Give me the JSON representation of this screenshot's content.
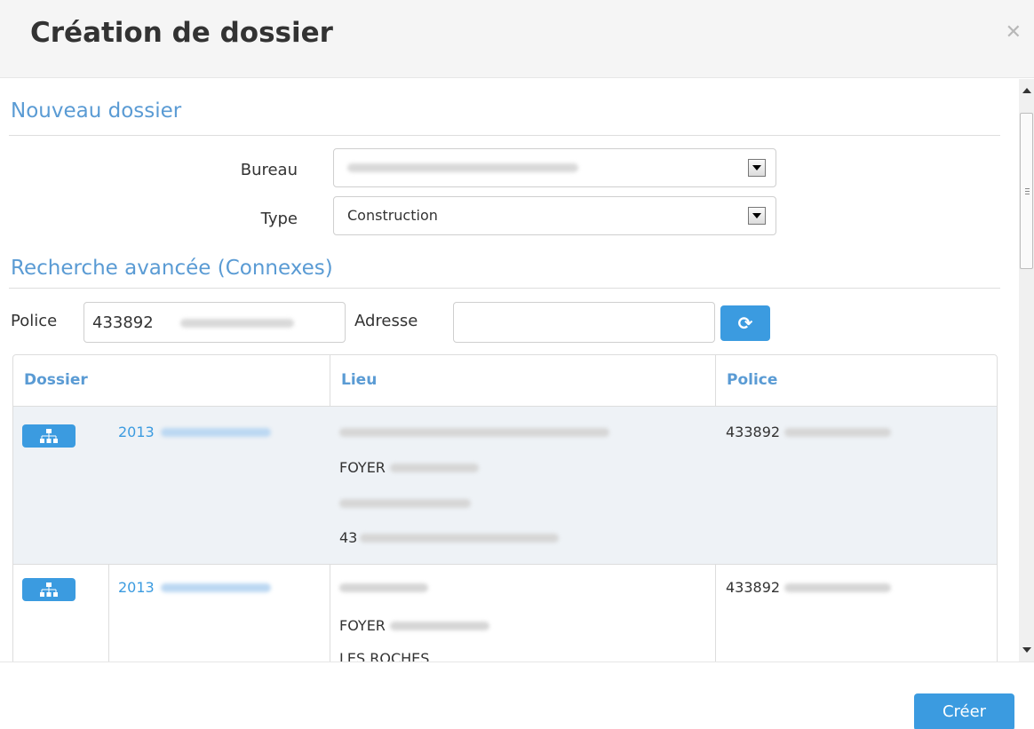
{
  "modal": {
    "title": "Création de dossier",
    "close_icon": "close-icon"
  },
  "nouveau": {
    "section_title": "Nouveau dossier",
    "bureau_label": "Bureau",
    "bureau_value": "",
    "type_label": "Type",
    "type_value": "Construction"
  },
  "recherche": {
    "section_title": "Recherche avancée (Connexes)",
    "police_label": "Police",
    "police_value": "433892",
    "adresse_label": "Adresse",
    "adresse_value": "",
    "refresh_icon": "refresh-icon"
  },
  "table": {
    "headers": [
      "Dossier",
      "Lieu",
      "Police"
    ],
    "rows": [
      {
        "dossier": "2013",
        "lieu": [
          "",
          "FOYER",
          "",
          "43"
        ],
        "police": "433892"
      },
      {
        "dossier": "2013",
        "lieu": [
          "",
          "FOYER",
          "LES ROCHES"
        ],
        "police": "433892"
      }
    ]
  },
  "footer": {
    "create_label": "Créer"
  },
  "colors": {
    "accent": "#3b9be0",
    "section_title": "#5a9bd4"
  }
}
